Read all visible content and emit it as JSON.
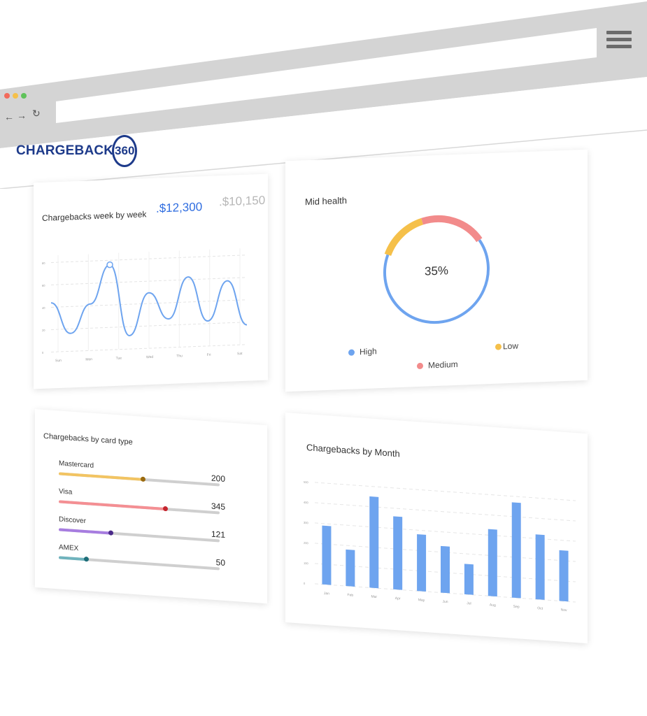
{
  "brand": {
    "name": "CHARGEBACK",
    "number": "360",
    "color": "#1d3a8a"
  },
  "chrome": {
    "back_icon": "arrow-left-icon",
    "forward_icon": "arrow-right-icon",
    "reload_icon": "reload-icon",
    "menu_icon": "hamburger-icon",
    "traffic_colors": [
      "#f26b5b",
      "#f5c04a",
      "#5fc25a"
    ]
  },
  "week_card": {
    "title": "Chargebacks week by week",
    "primary_value": ".$12,300",
    "secondary_value": ".$10,150",
    "primary_color": "#2f6de0",
    "secondary_color": "#b7b7b7"
  },
  "health_card": {
    "title": "Mid health",
    "center_label": "35%",
    "colors": {
      "high": "#6ea4ef",
      "medium": "#f28b8b",
      "low": "#f5c04a"
    },
    "legend": [
      {
        "label": "High",
        "color": "#6ea4ef"
      },
      {
        "label": "Low",
        "color": "#f5c04a"
      },
      {
        "label": "Medium",
        "color": "#f28b8b"
      }
    ]
  },
  "type_card": {
    "title": "Chargebacks by card type",
    "rows": [
      {
        "label": "Mastercard",
        "count": "200",
        "fill": 0.52,
        "color": "#f2c462",
        "knob": "#9a6a10"
      },
      {
        "label": "Visa",
        "count": "345",
        "fill": 0.66,
        "color": "#f48f93",
        "knob": "#c4262f"
      },
      {
        "label": "Discover",
        "count": "121",
        "fill": 0.32,
        "color": "#a77de0",
        "knob": "#4b2a8a"
      },
      {
        "label": "AMEX",
        "count": "50",
        "fill": 0.17,
        "color": "#6fb3bd",
        "knob": "#1d6d78"
      }
    ]
  },
  "month_card": {
    "title": "Chargebacks by Month",
    "bar_color": "#6ea4ef"
  },
  "chart_data": [
    {
      "type": "line",
      "title": "Chargebacks week by week",
      "x": [
        "Sun",
        "Mon",
        "Tue",
        "Wed",
        "Thu",
        "Fri",
        "Sat"
      ],
      "y": [
        0.55,
        0.45,
        0.95,
        0.38,
        0.78,
        0.58,
        0.22
      ],
      "detail_points": [
        0.55,
        0.2,
        0.52,
        0.95,
        0.15,
        0.62,
        0.32,
        0.78,
        0.28,
        0.72,
        0.22
      ],
      "y_ticks": [
        "80",
        "60",
        "40",
        "20",
        "0"
      ],
      "grid": true,
      "color": "#6ea4ef"
    },
    {
      "type": "pie",
      "title": "Mid health",
      "slices": [
        {
          "name": "High",
          "value": 65
        },
        {
          "name": "Medium",
          "value": 20
        },
        {
          "name": "Low",
          "value": 15
        }
      ]
    },
    {
      "type": "bar",
      "title": "Chargebacks by card type",
      "categories": [
        "Mastercard",
        "Visa",
        "Discover",
        "AMEX"
      ],
      "values": [
        200,
        345,
        121,
        50
      ]
    },
    {
      "type": "bar",
      "title": "Chargebacks by Month",
      "categories": [
        "Jan",
        "Feb",
        "Mar",
        "Apr",
        "May",
        "Jun",
        "Jul",
        "Aug",
        "Sep",
        "Oct",
        "Nov"
      ],
      "values": [
        290,
        180,
        450,
        360,
        280,
        230,
        150,
        330,
        470,
        320,
        250
      ],
      "y_ticks": [
        "500",
        "400",
        "300",
        "200",
        "100",
        "0"
      ],
      "ylim": [
        0,
        500
      ],
      "grid": true
    }
  ]
}
